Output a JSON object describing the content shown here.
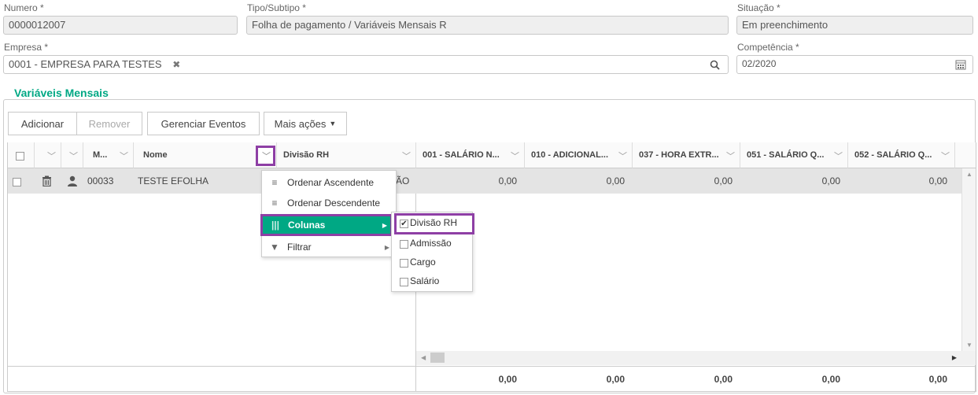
{
  "form": {
    "numero_label": "Numero *",
    "numero_value": "0000012007",
    "tipo_label": "Tipo/Subtipo *",
    "tipo_value": "Folha de pagamento / Variáveis Mensais R",
    "situacao_label": "Situação *",
    "situacao_value": "Em preenchimento",
    "empresa_label": "Empresa *",
    "empresa_value": "0001 - EMPRESA PARA TESTES",
    "competencia_label": "Competência *",
    "competencia_value": "02/2020"
  },
  "section_title": "Variáveis Mensais",
  "toolbar": {
    "add": "Adicionar",
    "remove": "Remover",
    "manage": "Gerenciar Eventos",
    "more": "Mais ações"
  },
  "columns": {
    "m": "M...",
    "nome": "Nome",
    "divisao": "Divisão RH",
    "c001": "001 - SALÁRIO N...",
    "c010": "010 - ADICIONAL...",
    "c037": "037 - HORA EXTR...",
    "c051": "051 - SALÁRIO Q...",
    "c052": "052 - SALÁRIO Q..."
  },
  "row": {
    "code": "00033",
    "name": "TESTE EFOLHA",
    "divisao_partial": "ÃO",
    "v001": "0,00",
    "v010": "0,00",
    "v037": "0,00",
    "v051": "0,00",
    "v052": "0,00"
  },
  "totals": {
    "t001": "0,00",
    "t010": "0,00",
    "t037": "0,00",
    "t051": "0,00",
    "t052": "0,00"
  },
  "column_menu": {
    "asc": "Ordenar Ascendente",
    "desc": "Ordenar Descendente",
    "columns": "Colunas",
    "filter": "Filtrar"
  },
  "columns_submenu": {
    "divisao": "Divisão RH",
    "admissao": "Admissão",
    "cargo": "Cargo",
    "salario": "Salário"
  },
  "colors": {
    "accent": "#00a884",
    "highlight_border": "#8e3fa5",
    "row_bg": "#e4e4e4"
  }
}
